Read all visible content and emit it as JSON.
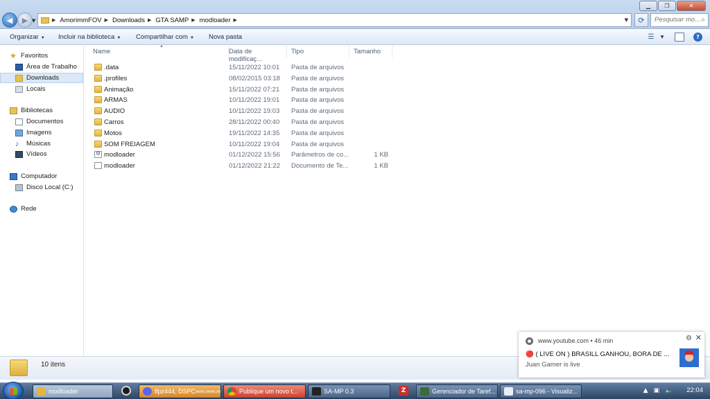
{
  "address": {
    "crumbs": [
      "AmorimmFOV",
      "Downloads",
      "GTA SAMP",
      "modloader"
    ],
    "search_placeholder": "Pesquisar mo..."
  },
  "toolbar": {
    "organize": "Organizar",
    "include": "Incluir na biblioteca",
    "share": "Compartilhar com",
    "new_folder": "Nova pasta"
  },
  "nav": {
    "favorites": "Favoritos",
    "desktop": "Área de Trabalho",
    "downloads": "Downloads",
    "recent": "Locais",
    "libraries": "Bibliotecas",
    "documents": "Documentos",
    "images": "Imagens",
    "music": "Músicas",
    "videos": "Vídeos",
    "computer": "Computador",
    "disk": "Disco Local (C:)",
    "network": "Rede"
  },
  "columns": {
    "name": "Name",
    "date": "Data de modificaç...",
    "type": "Tipo",
    "size": "Tamanho"
  },
  "files": [
    {
      "name": ".data",
      "date": "15/11/2022 10:01",
      "type": "Pasta de arquivos",
      "size": "",
      "icon": "folder-icon"
    },
    {
      "name": ".profiles",
      "date": "08/02/2015 03:18",
      "type": "Pasta de arquivos",
      "size": "",
      "icon": "folder-icon"
    },
    {
      "name": "Animação",
      "date": "15/11/2022 07:21",
      "type": "Pasta de arquivos",
      "size": "",
      "icon": "folder-icon"
    },
    {
      "name": "ARMAS",
      "date": "10/11/2022 19:01",
      "type": "Pasta de arquivos",
      "size": "",
      "icon": "folder-icon"
    },
    {
      "name": "AUDIO",
      "date": "10/11/2022 19:03",
      "type": "Pasta de arquivos",
      "size": "",
      "icon": "folder-icon"
    },
    {
      "name": "Carros",
      "date": "28/11/2022 00:40",
      "type": "Pasta de arquivos",
      "size": "",
      "icon": "folder-icon"
    },
    {
      "name": "Motos",
      "date": "19/11/2022 14:35",
      "type": "Pasta de arquivos",
      "size": "",
      "icon": "folder-icon"
    },
    {
      "name": "SOM FREIAGEM",
      "date": "10/11/2022 19:04",
      "type": "Pasta de arquivos",
      "size": "",
      "icon": "folder-icon"
    },
    {
      "name": "modloader",
      "date": "01/12/2022 15:56",
      "type": "Parâmetros de co...",
      "size": "1 KB",
      "icon": "settings-file-icon"
    },
    {
      "name": "modloader",
      "date": "01/12/2022 21:22",
      "type": "Documento de Te...",
      "size": "1 KB",
      "icon": "text-file-icon"
    }
  ],
  "details": {
    "count": "10 itens"
  },
  "toast": {
    "source": "www.youtube.com  •  46 min",
    "title": "🔴 ( LIVE ON ) BRASILL GANHOU, BORA DE ...",
    "body": "Juan Gamer is live"
  },
  "taskbar": {
    "items": [
      "modloader",
      "flpz444, DSPC══.══.═══",
      "Publique um novo t...",
      "SA-MP 0.3",
      "Gerenciador de Taref...",
      "sa-mp-096 - Visualiz..."
    ],
    "clock": "22:04"
  }
}
